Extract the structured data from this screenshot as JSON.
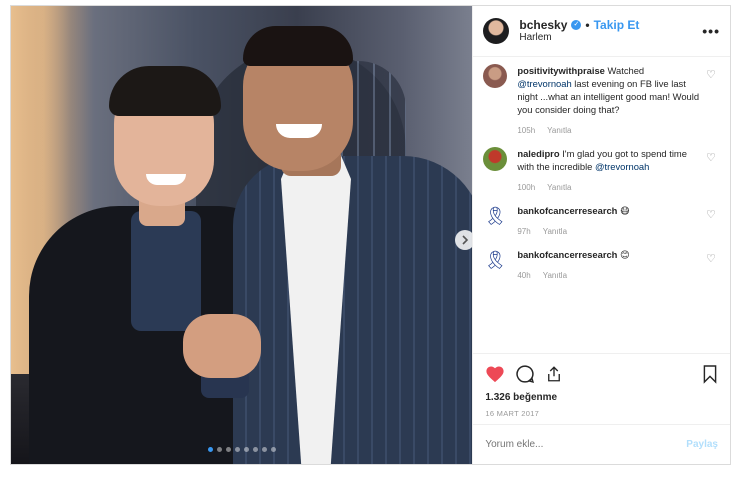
{
  "post": {
    "username": "bchesky",
    "follow_label": "Takip Et",
    "separator": "•",
    "location": "Harlem",
    "more_icon": "more-icon",
    "carousel_total": 8,
    "carousel_index": 1
  },
  "comments": [
    {
      "user": "positivitywithpraise",
      "text_before": "Watched ",
      "mention": "@trevornoah",
      "text_after": " last evening on FB live last night ...what an intelligent good man! Would you consider doing that?",
      "time": "105h",
      "reply": "Yanıtla",
      "avatar_color": "#8a5a50"
    },
    {
      "user": "naledipro",
      "text_before": "I'm glad you got to spend time with the incredible ",
      "mention": "@trevornoah",
      "text_after": "",
      "time": "100h",
      "reply": "Yanıtla",
      "avatar_color": "#6b8f3a"
    },
    {
      "user": "bankofcancerresearch",
      "emoji": "😷",
      "time": "97h",
      "reply": "Yanıtla",
      "avatar_icon": "ribbon-icon"
    },
    {
      "user": "bankofcancerresearch",
      "emoji": "😊",
      "time": "40h",
      "reply": "Yanıtla",
      "avatar_icon": "ribbon-icon"
    }
  ],
  "actions": {
    "likes": "1.326 beğenme",
    "date": "16 MART 2017"
  },
  "add_comment": {
    "placeholder": "Yorum ekle...",
    "post_label": "Paylaş"
  },
  "colors": {
    "accent": "#3897f0",
    "heart": "#ed4956",
    "ribbon": "#1d3b8c"
  }
}
